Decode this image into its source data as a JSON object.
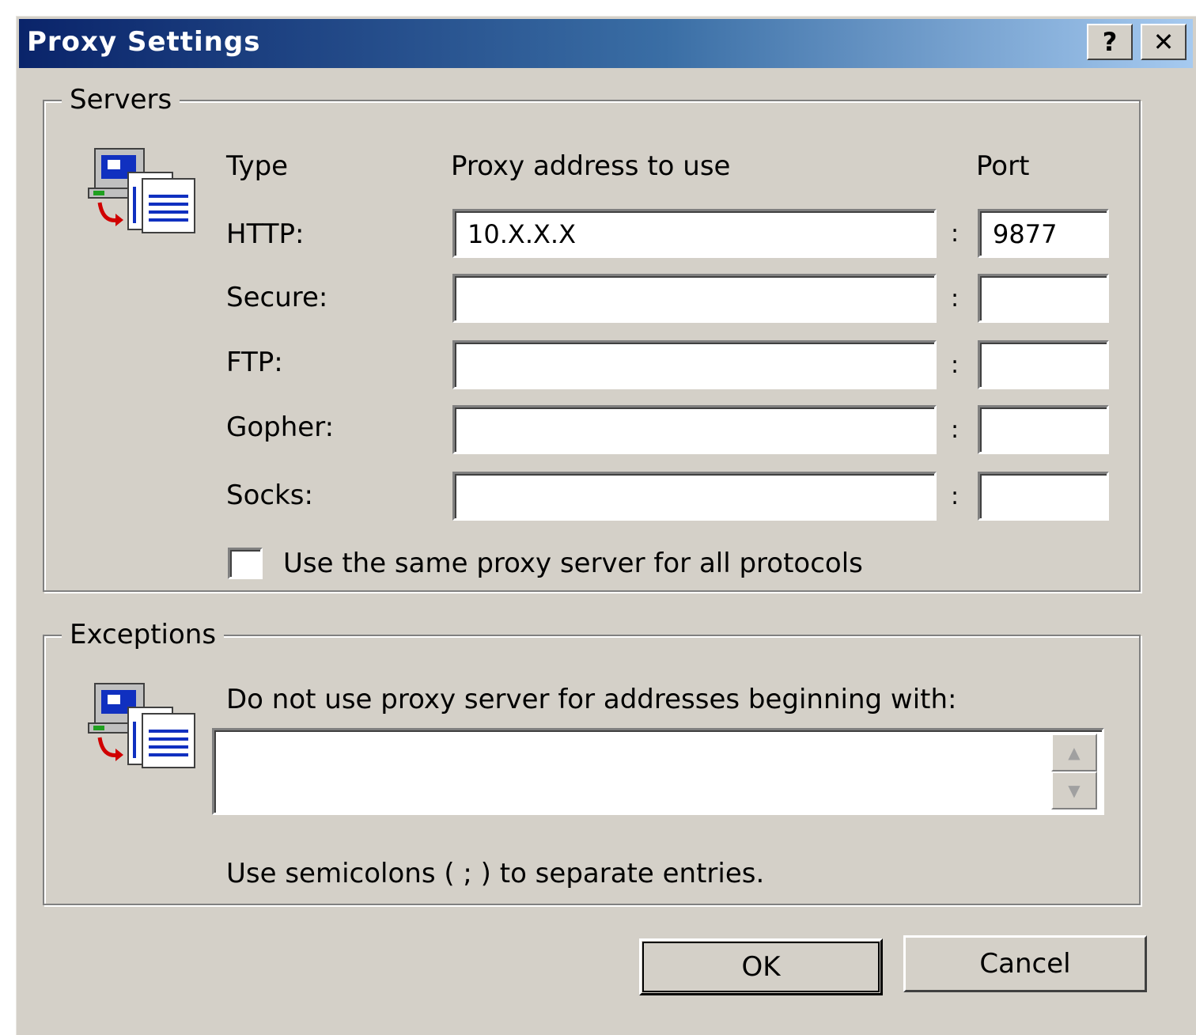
{
  "window": {
    "title": "Proxy Settings",
    "help_label": "?",
    "close_label": "✕"
  },
  "servers": {
    "legend": "Servers",
    "icon": "network-computer-icon",
    "headers": {
      "type": "Type",
      "address": "Proxy address to use",
      "port": "Port"
    },
    "separator": ":",
    "rows": [
      {
        "label": "HTTP:",
        "address": "10.X.X.X",
        "port": "9877"
      },
      {
        "label": "Secure:",
        "address": "",
        "port": ""
      },
      {
        "label": "FTP:",
        "address": "",
        "port": ""
      },
      {
        "label": "Gopher:",
        "address": "",
        "port": ""
      },
      {
        "label": "Socks:",
        "address": "",
        "port": ""
      }
    ],
    "same_proxy_label": "Use the same proxy server for all protocols",
    "same_proxy_checked": false
  },
  "exceptions": {
    "legend": "Exceptions",
    "icon": "network-computer-icon",
    "instruction": "Do not use proxy server for addresses beginning with:",
    "value": "",
    "hint": "Use semicolons ( ; ) to separate entries."
  },
  "buttons": {
    "ok": "OK",
    "cancel": "Cancel"
  },
  "colors": {
    "face": "#d4d0c8",
    "title_start": "#0a246a",
    "title_end": "#a6caf0"
  }
}
